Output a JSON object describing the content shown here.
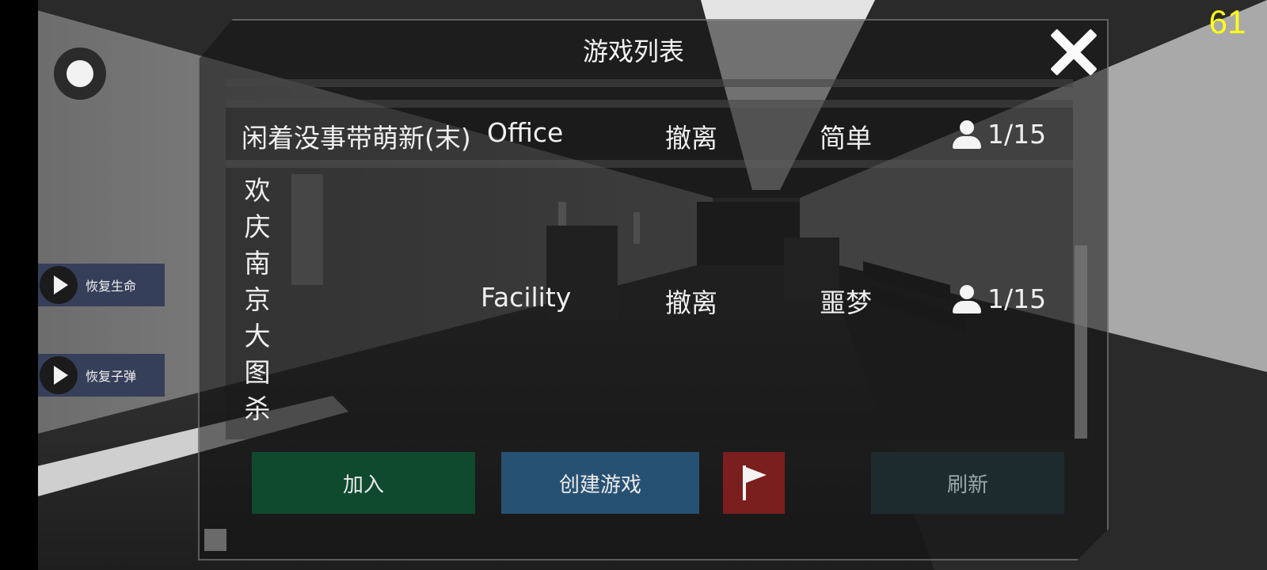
{
  "hud": {
    "fps": "61",
    "record_icon": "record-dot-icon",
    "side_buttons": [
      {
        "label": "恢复生命",
        "icon": "play-icon"
      },
      {
        "label": "恢复子弹",
        "icon": "play-icon"
      }
    ]
  },
  "dialog": {
    "title": "游戏列表",
    "close_icon": "close-icon"
  },
  "games": [
    {
      "name": "闲着没事带萌新(末)",
      "map": "Office",
      "mode": "撤离",
      "difficulty": "简单",
      "players": "1/15"
    },
    {
      "name_chars": [
        "欢",
        "庆",
        "南",
        "京",
        "大",
        "图",
        "杀"
      ],
      "map": "Facility",
      "mode": "撤离",
      "difficulty": "噩梦",
      "players": "1/15"
    }
  ],
  "buttons": {
    "join": "加入",
    "create": "创建游戏",
    "report_icon": "flag-icon",
    "refresh": "刷新"
  },
  "colors": {
    "fps": "#ffff1a",
    "join": "#0f4a2e",
    "create": "#275173",
    "report": "#7a1e1e",
    "refresh": "#1e2e32"
  }
}
